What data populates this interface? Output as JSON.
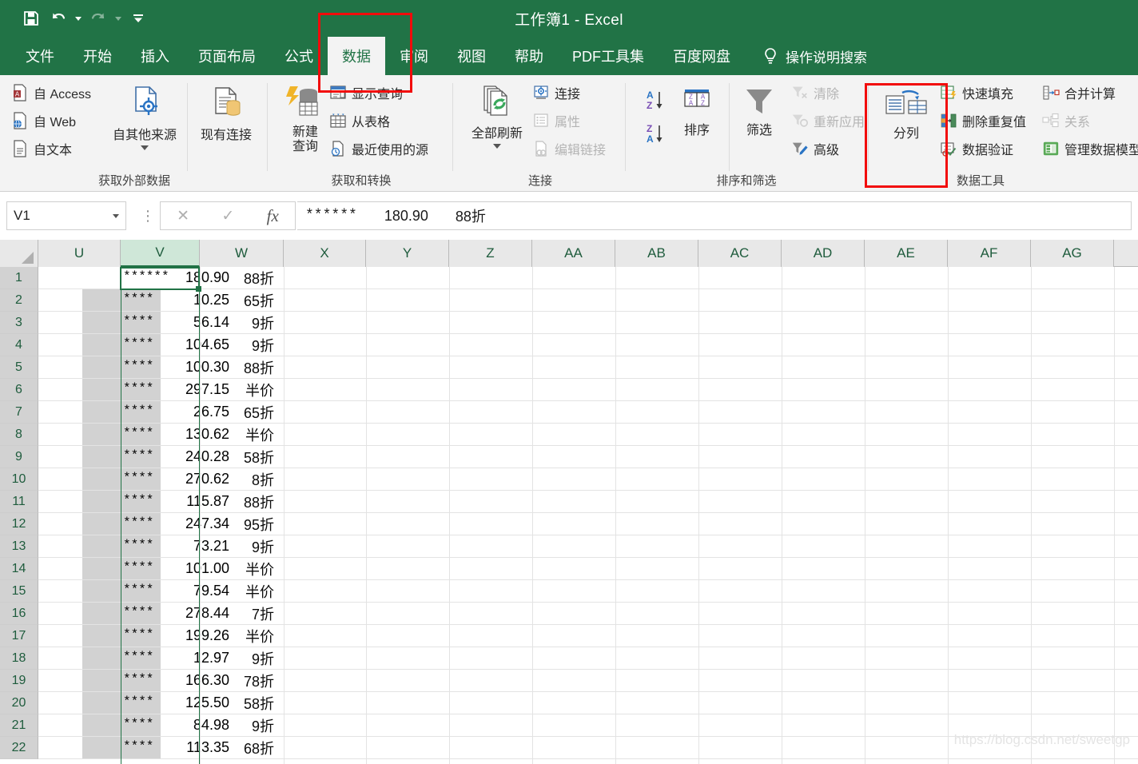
{
  "window": {
    "title": "工作簿1  -  Excel",
    "quick_access": [
      {
        "name": "save",
        "icon": "save-icon"
      },
      {
        "name": "undo",
        "icon": "undo-icon",
        "has_dropdown": true,
        "enabled": true
      },
      {
        "name": "redo",
        "icon": "redo-icon",
        "has_dropdown": true,
        "enabled": false
      },
      {
        "name": "customize",
        "icon": "customize-qat-icon"
      }
    ]
  },
  "tabs": [
    {
      "label": "文件",
      "active": false
    },
    {
      "label": "开始",
      "active": false
    },
    {
      "label": "插入",
      "active": false
    },
    {
      "label": "页面布局",
      "active": false
    },
    {
      "label": "公式",
      "active": false
    },
    {
      "label": "数据",
      "active": true
    },
    {
      "label": "审阅",
      "active": false
    },
    {
      "label": "视图",
      "active": false
    },
    {
      "label": "帮助",
      "active": false
    },
    {
      "label": "PDF工具集",
      "active": false
    },
    {
      "label": "百度网盘",
      "active": false
    }
  ],
  "tell_me": {
    "label": "操作说明搜索",
    "icon": "lightbulb-icon"
  },
  "ribbon": {
    "groups": [
      {
        "title": "获取外部数据",
        "small_items": [
          "自 Access",
          "自 Web",
          "自文本"
        ],
        "big_items": [
          {
            "label": "自其他来源",
            "dropdown": true
          },
          {
            "label": "现有连接",
            "dropdown": false
          }
        ]
      },
      {
        "title": "获取和转换",
        "big_items": [
          {
            "label": "新建\n查询",
            "dropdown": true
          }
        ],
        "small_items": [
          "显示查询",
          "从表格",
          "最近使用的源"
        ]
      },
      {
        "title": "连接",
        "big_items": [
          {
            "label": "全部刷新",
            "dropdown": true
          }
        ],
        "small_items": [
          "连接",
          "属性",
          "编辑链接"
        ],
        "disabled_items": [
          "属性",
          "编辑链接"
        ]
      },
      {
        "title": "排序和筛选",
        "small_items": [
          "排序",
          "筛选",
          "清除",
          "重新应用",
          "高级"
        ],
        "disabled_items": [
          "清除",
          "重新应用"
        ],
        "sort_az": "A↓Z",
        "sort_za": "Z↓A"
      },
      {
        "title": "数据工具",
        "big_items": [
          {
            "label": "分列",
            "dropdown": false
          }
        ],
        "small_items": [
          "快速填充",
          "删除重复值",
          "数据验证",
          "合并计算",
          "关系",
          "管理数据模型"
        ],
        "disabled_items": [
          "关系"
        ]
      }
    ]
  },
  "formula_bar": {
    "name_box": "V1",
    "cancel_icon": "cancel-icon",
    "confirm_icon": "confirm-icon",
    "function_icon": "fx-icon",
    "content_parts": [
      "******",
      "180.90",
      "88折"
    ]
  },
  "grid": {
    "columns": [
      "U",
      "V",
      "W",
      "X",
      "Y",
      "Z",
      "AA",
      "AB",
      "AC",
      "AD",
      "AE",
      "AF",
      "AG"
    ],
    "selected_column": "V",
    "active_cell": "V1",
    "row_numbers": [
      1,
      2,
      3,
      4,
      5,
      6,
      7,
      8,
      9,
      10,
      11,
      12,
      13,
      14,
      15,
      16,
      17,
      18,
      19,
      20,
      21,
      22
    ],
    "rows": [
      {
        "row": 1,
        "stars": "******",
        "number": "180.90",
        "discount": "88折"
      },
      {
        "row": 2,
        "stars": "****",
        "number": "10.25",
        "discount": "65折"
      },
      {
        "row": 3,
        "stars": "****",
        "number": "56.14",
        "discount": "9折"
      },
      {
        "row": 4,
        "stars": "****",
        "number": "104.65",
        "discount": "9折"
      },
      {
        "row": 5,
        "stars": "****",
        "number": "100.30",
        "discount": "88折"
      },
      {
        "row": 6,
        "stars": "****",
        "number": "297.15",
        "discount": "半价"
      },
      {
        "row": 7,
        "stars": "****",
        "number": "26.75",
        "discount": "65折"
      },
      {
        "row": 8,
        "stars": "****",
        "number": "130.62",
        "discount": "半价"
      },
      {
        "row": 9,
        "stars": "****",
        "number": "240.28",
        "discount": "58折"
      },
      {
        "row": 10,
        "stars": "****",
        "number": "270.62",
        "discount": "8折"
      },
      {
        "row": 11,
        "stars": "****",
        "number": "115.87",
        "discount": "88折"
      },
      {
        "row": 12,
        "stars": "****",
        "number": "247.34",
        "discount": "95折"
      },
      {
        "row": 13,
        "stars": "****",
        "number": "73.21",
        "discount": "9折"
      },
      {
        "row": 14,
        "stars": "****",
        "number": "101.00",
        "discount": "半价"
      },
      {
        "row": 15,
        "stars": "****",
        "number": "79.54",
        "discount": "半价"
      },
      {
        "row": 16,
        "stars": "****",
        "number": "278.44",
        "discount": "7折"
      },
      {
        "row": 17,
        "stars": "****",
        "number": "199.26",
        "discount": "半价"
      },
      {
        "row": 18,
        "stars": "****",
        "number": "12.97",
        "discount": "9折"
      },
      {
        "row": 19,
        "stars": "****",
        "number": "166.30",
        "discount": "78折"
      },
      {
        "row": 20,
        "stars": "****",
        "number": "125.50",
        "discount": "58折"
      },
      {
        "row": 21,
        "stars": "****",
        "number": "84.98",
        "discount": "9折"
      },
      {
        "row": 22,
        "stars": "****",
        "number": "113.35",
        "discount": "68折"
      }
    ]
  },
  "watermark": "https://blog.csdn.net/sweetgp",
  "colors": {
    "excel_green": "#217346",
    "ribbon_bg": "#f3f3f3",
    "annotation_red": "#f20b0b",
    "selection_shade": "#d2d2d2",
    "column_header_sel": "#cfe7d8"
  },
  "annotations": [
    {
      "name": "data-tab-highlight"
    },
    {
      "name": "text-to-columns-highlight"
    }
  ]
}
